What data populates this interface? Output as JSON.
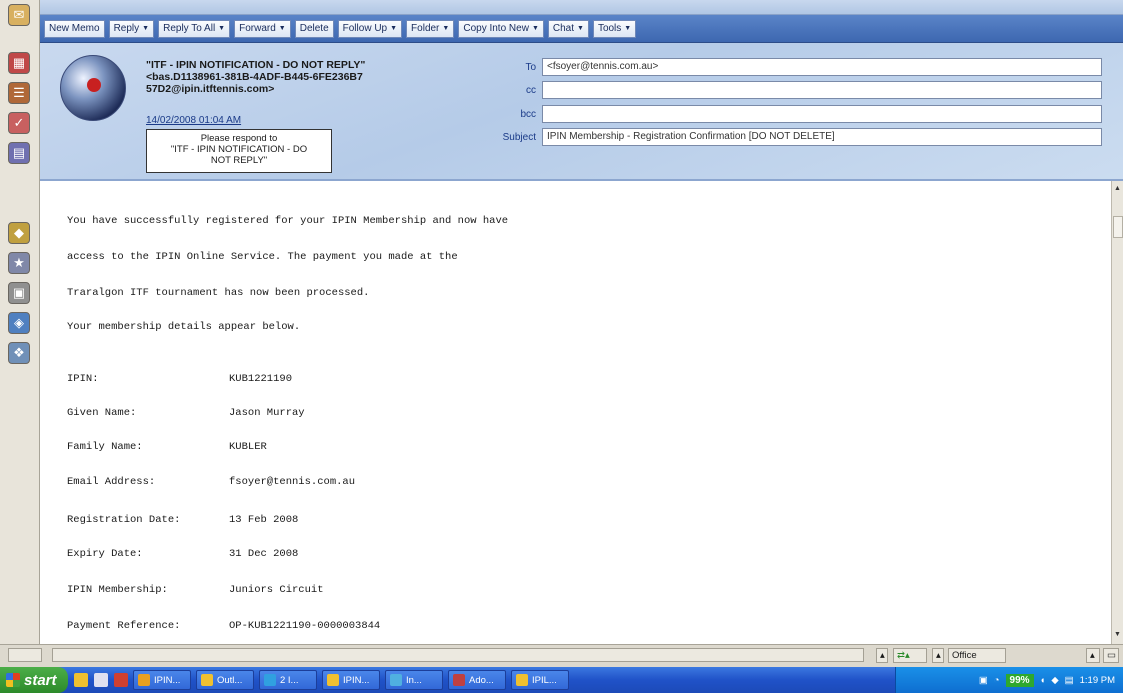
{
  "toolbar": {
    "buttons": [
      {
        "label": "New Memo",
        "dropdown": false
      },
      {
        "label": "Reply",
        "dropdown": true
      },
      {
        "label": "Reply To All",
        "dropdown": true
      },
      {
        "label": "Forward",
        "dropdown": true
      },
      {
        "label": "Delete",
        "dropdown": false
      },
      {
        "label": "Follow Up",
        "dropdown": true
      },
      {
        "label": "Folder",
        "dropdown": true
      },
      {
        "label": "Copy Into New",
        "dropdown": true
      },
      {
        "label": "Chat",
        "dropdown": true
      },
      {
        "label": "Tools",
        "dropdown": true
      }
    ]
  },
  "header": {
    "from_line1": "\"ITF - IPIN NOTIFICATION - DO NOT REPLY\"",
    "from_line2": "<bas.D1138961-381B-4ADF-B445-6FE236B7",
    "from_line3": "57D2@ipin.itftennis.com>",
    "date": "14/02/2008 01:04 AM",
    "respond_line1": "Please respond to",
    "respond_line2": "\"ITF - IPIN NOTIFICATION - DO",
    "respond_line3": "NOT REPLY\"",
    "to_label": "To",
    "cc_label": "cc",
    "bcc_label": "bcc",
    "subject_label": "Subject",
    "to_value": "<fsoyer@tennis.com.au>",
    "cc_value": "",
    "bcc_value": "",
    "subject_value": "IPIN Membership - Registration Confirmation [DO NOT DELETE]"
  },
  "body": {
    "p1": "You have successfully registered for your IPIN Membership and now have",
    "p2": "access to the IPIN Online Service. The payment you made at the",
    "p3": "Traralgon ITF tournament has now been processed.",
    "p4": "Your membership details appear below.",
    "details": [
      {
        "label": "IPIN:",
        "value": "KUB1221190"
      },
      {
        "label": "Given Name:",
        "value": "Jason Murray"
      },
      {
        "label": "Family Name:",
        "value": "KUBLER"
      },
      {
        "label": "Email Address:",
        "value": "fsoyer@tennis.com.au"
      },
      {
        "label": "Registration Date:",
        "value": "13 Feb 2008"
      },
      {
        "label": "Expiry Date:",
        "value": "31 Dec 2008"
      },
      {
        "label": "IPIN Membership:",
        "value": "Juniors Circuit"
      },
      {
        "label": "Payment Reference:",
        "value": "OP-KUB1221190-0000003844"
      }
    ]
  },
  "statusbar": {
    "location": "Office"
  },
  "taskbar": {
    "start": "start",
    "items": [
      {
        "label": "IPIN...",
        "color": "#e8a020"
      },
      {
        "label": "Outl...",
        "color": "#f0c030"
      },
      {
        "label": "2 I...",
        "color": "#30a0e0"
      },
      {
        "label": "IPIN...",
        "color": "#f0c030"
      },
      {
        "label": "In...",
        "color": "#50b0e0"
      },
      {
        "label": "Ado...",
        "color": "#c04040"
      },
      {
        "label": "IPIL...",
        "color": "#f0c030"
      }
    ],
    "battery": "99%",
    "clock": "1:19 PM"
  },
  "colors": {
    "action_bar": "#3d67b0",
    "header_bg": "#c9d9ef",
    "taskbar": "#2052c8",
    "start_green": "#2c8a2a"
  }
}
